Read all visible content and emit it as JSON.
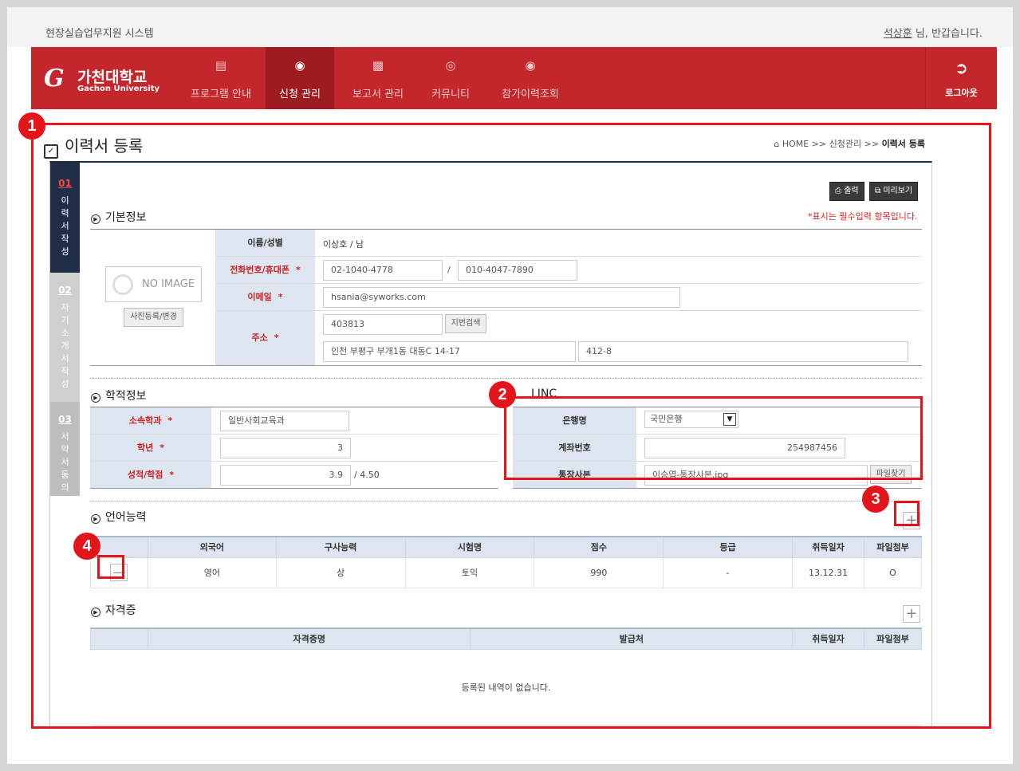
{
  "header": {
    "system_name": "현장실습업무지원 시스템",
    "user_name": "석상훈",
    "greeting": " 님, 반갑습니다."
  },
  "logo": {
    "mark": "G",
    "kr": "가천대학교",
    "en": "Gachon University"
  },
  "nav": {
    "items": [
      {
        "label": "프로그램 안내",
        "icon": "document-icon"
      },
      {
        "label": "신청 관리",
        "icon": "search-icon",
        "active": true
      },
      {
        "label": "보고서 관리",
        "icon": "folder-icon"
      },
      {
        "label": "커뮤니티",
        "icon": "broadcast-icon"
      },
      {
        "label": "참가이력조회",
        "icon": "search-icon"
      }
    ],
    "logout": "로그아웃"
  },
  "page": {
    "title": "이력서 등록",
    "breadcrumb": {
      "home": "HOME",
      "sep": ">>",
      "mid": "신청관리",
      "current": "이력서 등록"
    }
  },
  "steps": [
    {
      "no": "01",
      "label": "이력서작성"
    },
    {
      "no": "02",
      "label": "자기소개서작성"
    },
    {
      "no": "03",
      "label": "서약서동의"
    }
  ],
  "toolbar": {
    "print": "출력",
    "preview": "미리보기"
  },
  "required_note": "*표시는 필수입력 항목입니다.",
  "basic": {
    "section": "기본정보",
    "no_image": "NO IMAGE",
    "photo_button": "사진등록/변경",
    "name_label": "이름/성별",
    "name_value": "이상호 / 남",
    "phone_label": "전화번호/휴대폰",
    "phone": "02-1040-4778",
    "phone_sep": "/",
    "mobile": "010-4047-7890",
    "email_label": "이메일",
    "email": "hsania@syworks.com",
    "address_label": "주소",
    "zipcode": "403813",
    "zip_button": "지번검색",
    "address1": "인천 부평구 부개1동 대동C 14-17",
    "address2": "412-8",
    "star": "*"
  },
  "academic": {
    "section": "학적정보",
    "dept_label": "소속학과",
    "dept": "일반사회교육과",
    "year_label": "학년",
    "year": "3",
    "grade_label": "성적/학점",
    "grade": "3.9",
    "grade_max": "/ 4.50"
  },
  "linc": {
    "section": "LINC",
    "bank_label": "은행명",
    "bank": "국민은행",
    "account_label": "계좌번호",
    "account": "254987456",
    "passbook_label": "통장사본",
    "passbook_file": "이승엽-통장사본.jpg",
    "file_button": "파일찾기"
  },
  "language": {
    "section": "언어능력",
    "columns": [
      "외국어",
      "구사능력",
      "시험명",
      "점수",
      "등급",
      "취득일자",
      "파일첨부"
    ],
    "rows": [
      [
        "영어",
        "상",
        "토익",
        "990",
        "-",
        "13.12.31",
        "O"
      ]
    ]
  },
  "certificate": {
    "section": "자격증",
    "columns": [
      "자격증명",
      "발급처",
      "취득일자",
      "파일첨부"
    ],
    "empty": "등록된 내역이 없습니다."
  },
  "callouts": [
    "1",
    "2",
    "3",
    "4"
  ],
  "colors": {
    "brand_red": "#c3272b",
    "nav_active": "#9e1c20",
    "step_active": "#1f2d46",
    "highlight": "#e4141b"
  }
}
